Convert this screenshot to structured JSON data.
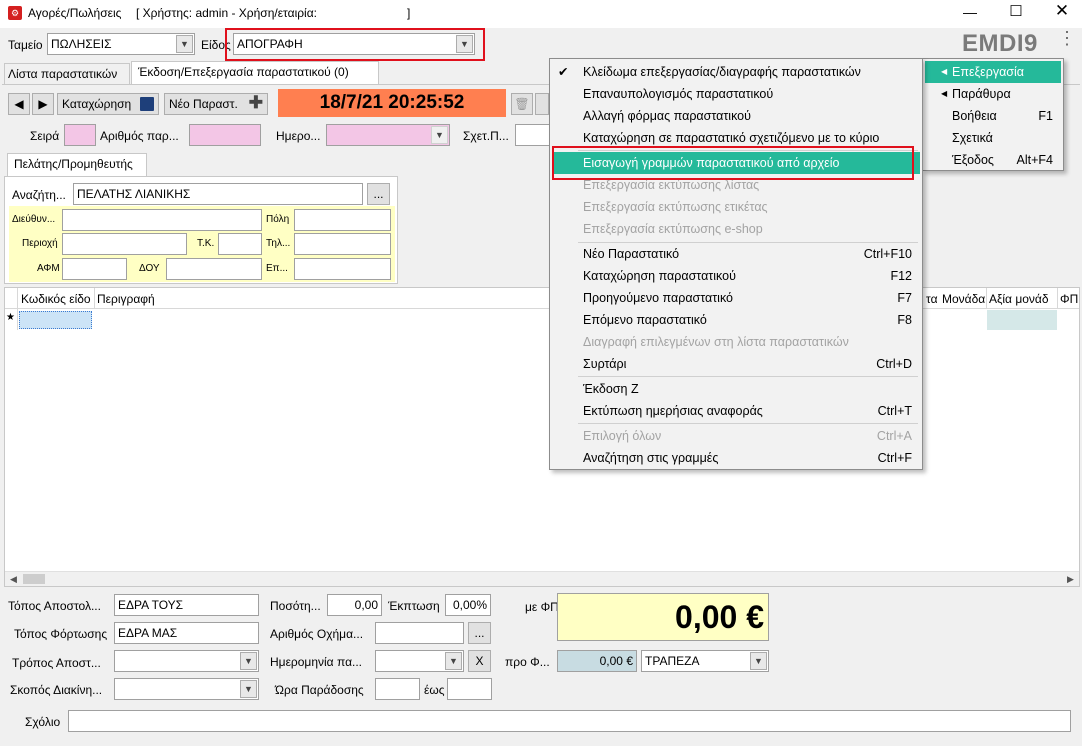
{
  "window": {
    "title": "Αγορές/Πωλήσεις",
    "user_info": "[ Χρήστης: admin - Χρήση/εταιρία:",
    "user_info_end": "]",
    "brand": "EMDI9"
  },
  "header": {
    "tameio_label": "Ταμείο",
    "tameio_value": "ΠΩΛΗΣΕΙΣ",
    "eidos_label": "Είδος",
    "eidos_value": "ΑΠΟΓΡΑΦΗ"
  },
  "tabs": [
    {
      "label": "Λίστα παραστατικών"
    },
    {
      "label": "Έκδοση/Επεξεργασία παραστατικού (0)"
    }
  ],
  "toolbar": {
    "save_label": "Καταχώρηση",
    "new_label": "Νέο Παραστ.",
    "datetime": "18/7/21 20:25:52"
  },
  "doc_fields": {
    "seira_label": "Σειρά",
    "arithmos_label": "Αριθμός παρ...",
    "imerominia_label": "Ημερο...",
    "sxet_label": "Σχετ.Π..."
  },
  "customer": {
    "tab_label": "Πελάτης/Προμηθευτής",
    "search_label": "Αναζήτη...",
    "search_value": "ΠΕΛΑΤΗΣ ΛΙΑΝΙΚΗΣ",
    "browse_label": "...",
    "address_label": "Διεύθυν...",
    "city_label": "Πόλη",
    "area_label": "Περιοχή",
    "tk_label": "Τ.Κ.",
    "phone_label": "Τηλ...",
    "afm_label": "ΑΦΜ",
    "doy_label": "ΔΟΥ",
    "ep_label": "Επ..."
  },
  "grid": {
    "columns_left": [
      "Κωδικός είδο",
      "Περιγραφή"
    ],
    "columns_right": [
      "τα",
      "Μονάδα",
      "Αξία μονάδ",
      "ΦΠ"
    ],
    "new_row_marker": "★"
  },
  "footer": {
    "topos_apostolis_label": "Τόπος Αποστολ...",
    "topos_apostolis_value": "ΕΔΡΑ ΤΟΥΣ",
    "topos_fortosis_label": "Τόπος Φόρτωσης",
    "topos_fortosis_value": "ΕΔΡΑ ΜΑΣ",
    "tropos_label": "Τρόπος Αποστ...",
    "skopos_label": "Σκοπός Διακίνη...",
    "posotita_label": "Ποσότη...",
    "posotita_value": "0,00",
    "ekptosi_label": "Έκπτωση",
    "ekptosi_value": "0,00%",
    "oxima_label": "Αριθμός Οχήμα...",
    "oxima_btn": "...",
    "imerominia_label": "Ημερομηνία πα...",
    "clear_btn": "X",
    "ora_label": "Ώρα Παράδοσης",
    "eos_label": "έως",
    "me_fpa_label": "με ΦΠΑ",
    "total": "0,00 €",
    "pro_label": "προ Φ...",
    "pro_value": "0,00 €",
    "payment": "ΤΡΑΠΕΖΑ",
    "comment_label": "Σχόλιο"
  },
  "right_menu": {
    "items": [
      {
        "label": "Επεξεργασία",
        "shortcut": ""
      },
      {
        "label": "Παράθυρα",
        "shortcut": ""
      },
      {
        "label": "Βοήθεια",
        "shortcut": "F1"
      },
      {
        "label": "Σχετικά",
        "shortcut": ""
      },
      {
        "label": "Έξοδος",
        "shortcut": "Alt+F4"
      }
    ]
  },
  "edit_menu": {
    "items": [
      {
        "label": "Κλείδωμα επεξεργασίας/διαγραφής παραστατικών",
        "shortcut": ""
      },
      {
        "label": "Επαναυπολογισμός παραστατικού",
        "shortcut": ""
      },
      {
        "label": "Αλλαγή φόρμας παραστατικού",
        "shortcut": ""
      },
      {
        "label": "Καταχώρηση σε παραστατικό σχετιζόμενο με το κύριο",
        "shortcut": ""
      },
      {
        "label": "Εισαγωγή γραμμών παραστατικού από αρχείο",
        "shortcut": ""
      },
      {
        "label": "Επεξεργασία εκτύπωσης λίστας",
        "shortcut": ""
      },
      {
        "label": "Επεξεργασία εκτύπωσης ετικέτας",
        "shortcut": ""
      },
      {
        "label": "Επεξεργασία εκτύπωσης e-shop",
        "shortcut": ""
      },
      {
        "label": "Νέο Παραστατικό",
        "shortcut": "Ctrl+F10"
      },
      {
        "label": "Καταχώρηση παραστατικού",
        "shortcut": "F12"
      },
      {
        "label": "Προηγούμενο παραστατικό",
        "shortcut": "F7"
      },
      {
        "label": "Επόμενο παραστατικό",
        "shortcut": "F8"
      },
      {
        "label": "Διαγραφή επιλεγμένων στη λίστα παραστατικών",
        "shortcut": ""
      },
      {
        "label": "Συρτάρι",
        "shortcut": "Ctrl+D"
      },
      {
        "label": "Έκδοση Ζ",
        "shortcut": ""
      },
      {
        "label": "Εκτύπωση ημερήσιας αναφοράς",
        "shortcut": "Ctrl+T"
      },
      {
        "label": "Επιλογή όλων",
        "shortcut": "Ctrl+A"
      },
      {
        "label": "Αναζήτηση στις γραμμές",
        "shortcut": "Ctrl+F"
      }
    ]
  },
  "colors": {
    "accent": "#25b99a",
    "datetime_bg": "#ff7f50",
    "pink": "#f3c6e6",
    "yellow": "#ffffc4",
    "highlight_box": "#e0101c"
  }
}
